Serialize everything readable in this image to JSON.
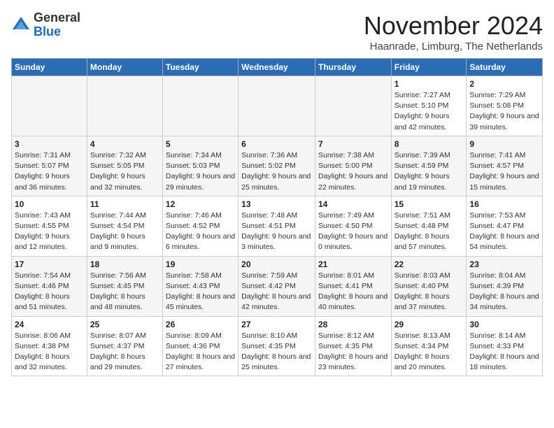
{
  "header": {
    "logo_general": "General",
    "logo_blue": "Blue",
    "month_title": "November 2024",
    "subtitle": "Haanrade, Limburg, The Netherlands"
  },
  "weekdays": [
    "Sunday",
    "Monday",
    "Tuesday",
    "Wednesday",
    "Thursday",
    "Friday",
    "Saturday"
  ],
  "weeks": [
    [
      {
        "day": "",
        "info": ""
      },
      {
        "day": "",
        "info": ""
      },
      {
        "day": "",
        "info": ""
      },
      {
        "day": "",
        "info": ""
      },
      {
        "day": "",
        "info": ""
      },
      {
        "day": "1",
        "info": "Sunrise: 7:27 AM\nSunset: 5:10 PM\nDaylight: 9 hours and 42 minutes."
      },
      {
        "day": "2",
        "info": "Sunrise: 7:29 AM\nSunset: 5:08 PM\nDaylight: 9 hours and 39 minutes."
      }
    ],
    [
      {
        "day": "3",
        "info": "Sunrise: 7:31 AM\nSunset: 5:07 PM\nDaylight: 9 hours and 36 minutes."
      },
      {
        "day": "4",
        "info": "Sunrise: 7:32 AM\nSunset: 5:05 PM\nDaylight: 9 hours and 32 minutes."
      },
      {
        "day": "5",
        "info": "Sunrise: 7:34 AM\nSunset: 5:03 PM\nDaylight: 9 hours and 29 minutes."
      },
      {
        "day": "6",
        "info": "Sunrise: 7:36 AM\nSunset: 5:02 PM\nDaylight: 9 hours and 25 minutes."
      },
      {
        "day": "7",
        "info": "Sunrise: 7:38 AM\nSunset: 5:00 PM\nDaylight: 9 hours and 22 minutes."
      },
      {
        "day": "8",
        "info": "Sunrise: 7:39 AM\nSunset: 4:59 PM\nDaylight: 9 hours and 19 minutes."
      },
      {
        "day": "9",
        "info": "Sunrise: 7:41 AM\nSunset: 4:57 PM\nDaylight: 9 hours and 15 minutes."
      }
    ],
    [
      {
        "day": "10",
        "info": "Sunrise: 7:43 AM\nSunset: 4:55 PM\nDaylight: 9 hours and 12 minutes."
      },
      {
        "day": "11",
        "info": "Sunrise: 7:44 AM\nSunset: 4:54 PM\nDaylight: 9 hours and 9 minutes."
      },
      {
        "day": "12",
        "info": "Sunrise: 7:46 AM\nSunset: 4:52 PM\nDaylight: 9 hours and 6 minutes."
      },
      {
        "day": "13",
        "info": "Sunrise: 7:48 AM\nSunset: 4:51 PM\nDaylight: 9 hours and 3 minutes."
      },
      {
        "day": "14",
        "info": "Sunrise: 7:49 AM\nSunset: 4:50 PM\nDaylight: 9 hours and 0 minutes."
      },
      {
        "day": "15",
        "info": "Sunrise: 7:51 AM\nSunset: 4:48 PM\nDaylight: 8 hours and 57 minutes."
      },
      {
        "day": "16",
        "info": "Sunrise: 7:53 AM\nSunset: 4:47 PM\nDaylight: 8 hours and 54 minutes."
      }
    ],
    [
      {
        "day": "17",
        "info": "Sunrise: 7:54 AM\nSunset: 4:46 PM\nDaylight: 8 hours and 51 minutes."
      },
      {
        "day": "18",
        "info": "Sunrise: 7:56 AM\nSunset: 4:45 PM\nDaylight: 8 hours and 48 minutes."
      },
      {
        "day": "19",
        "info": "Sunrise: 7:58 AM\nSunset: 4:43 PM\nDaylight: 8 hours and 45 minutes."
      },
      {
        "day": "20",
        "info": "Sunrise: 7:59 AM\nSunset: 4:42 PM\nDaylight: 8 hours and 42 minutes."
      },
      {
        "day": "21",
        "info": "Sunrise: 8:01 AM\nSunset: 4:41 PM\nDaylight: 8 hours and 40 minutes."
      },
      {
        "day": "22",
        "info": "Sunrise: 8:03 AM\nSunset: 4:40 PM\nDaylight: 8 hours and 37 minutes."
      },
      {
        "day": "23",
        "info": "Sunrise: 8:04 AM\nSunset: 4:39 PM\nDaylight: 8 hours and 34 minutes."
      }
    ],
    [
      {
        "day": "24",
        "info": "Sunrise: 8:06 AM\nSunset: 4:38 PM\nDaylight: 8 hours and 32 minutes."
      },
      {
        "day": "25",
        "info": "Sunrise: 8:07 AM\nSunset: 4:37 PM\nDaylight: 8 hours and 29 minutes."
      },
      {
        "day": "26",
        "info": "Sunrise: 8:09 AM\nSunset: 4:36 PM\nDaylight: 8 hours and 27 minutes."
      },
      {
        "day": "27",
        "info": "Sunrise: 8:10 AM\nSunset: 4:35 PM\nDaylight: 8 hours and 25 minutes."
      },
      {
        "day": "28",
        "info": "Sunrise: 8:12 AM\nSunset: 4:35 PM\nDaylight: 8 hours and 23 minutes."
      },
      {
        "day": "29",
        "info": "Sunrise: 8:13 AM\nSunset: 4:34 PM\nDaylight: 8 hours and 20 minutes."
      },
      {
        "day": "30",
        "info": "Sunrise: 8:14 AM\nSunset: 4:33 PM\nDaylight: 8 hours and 18 minutes."
      }
    ]
  ]
}
